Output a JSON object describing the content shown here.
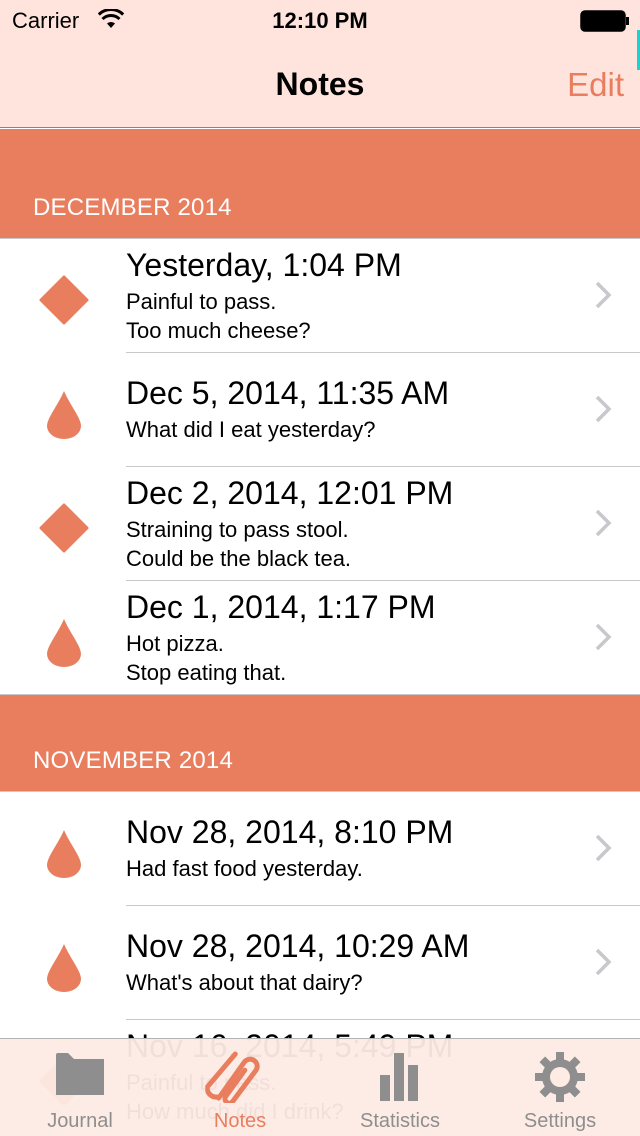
{
  "status_bar": {
    "carrier": "Carrier",
    "time": "12:10 PM"
  },
  "nav": {
    "title": "Notes",
    "edit_label": "Edit"
  },
  "colors": {
    "accent": "#e97e5f",
    "header_bg": "#fee4dc",
    "separator": "#c8c7cc",
    "tab_inactive": "#8e8e8e"
  },
  "sections": [
    {
      "header": "DECEMBER 2014",
      "rows": [
        {
          "icon": "diamond-icon",
          "title": "Yesterday, 1:04 PM",
          "line1": "Painful to pass.",
          "line2": "Too much cheese?"
        },
        {
          "icon": "drop-icon",
          "title": "Dec 5, 2014, 11:35 AM",
          "line1": "What did I eat yesterday?",
          "line2": ""
        },
        {
          "icon": "diamond-icon",
          "title": "Dec 2, 2014, 12:01 PM",
          "line1": "Straining to pass stool.",
          "line2": "Could be the black tea."
        },
        {
          "icon": "drop-icon",
          "title": "Dec 1, 2014, 1:17 PM",
          "line1": "Hot pizza.",
          "line2": "Stop eating that."
        }
      ]
    },
    {
      "header": "NOVEMBER 2014",
      "rows": [
        {
          "icon": "drop-icon",
          "title": "Nov 28, 2014, 8:10 PM",
          "line1": "Had fast food yesterday.",
          "line2": ""
        },
        {
          "icon": "drop-icon",
          "title": "Nov 28, 2014, 10:29 AM",
          "line1": "What's about that dairy?",
          "line2": ""
        },
        {
          "icon": "diamond-icon",
          "title": "Nov 16, 2014, 5:49 PM",
          "line1": "Painful to pass.",
          "line2": "How much did I drink?"
        }
      ]
    }
  ],
  "tabs": [
    {
      "label": "Journal",
      "icon": "folder-icon",
      "active": false
    },
    {
      "label": "Notes",
      "icon": "paperclip-icon",
      "active": true
    },
    {
      "label": "Statistics",
      "icon": "bar-chart-icon",
      "active": false
    },
    {
      "label": "Settings",
      "icon": "gear-icon",
      "active": false
    }
  ]
}
